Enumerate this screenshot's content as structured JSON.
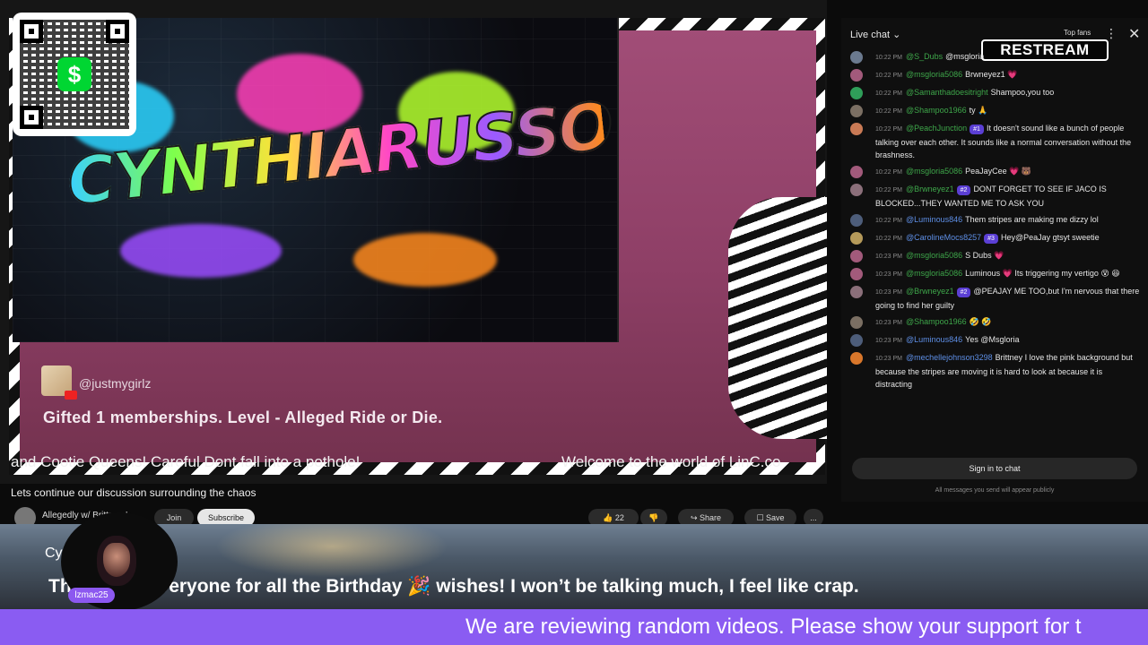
{
  "banner": {
    "title": "CYNTHIARUSSO"
  },
  "gift": {
    "username": "@justmygirlz",
    "message": "Gifted 1 memberships. Level - Alleged Ride or Die."
  },
  "tickers": {
    "top_left": "and Cootie Queens!  Careful Dont fall into a pothole!",
    "top_right": "Welcome to the world of LinC.co",
    "bottom": "We are reviewing random videos. Please show your support for t"
  },
  "video": {
    "title": "Lets continue our discussion surrounding the chaos",
    "channel": "Allegedly w/ Brittney L",
    "join_label": "Join",
    "subscribe_label": "Subscribe",
    "likes": "22",
    "share_label": "Share",
    "save_label": "Save",
    "more_label": "..."
  },
  "chat": {
    "header_label": "Live chat",
    "top_fans_label": "Top fans",
    "restream_label": "RESTREAM",
    "messages": [
      {
        "time": "10:22 PM",
        "user": "@S_Dubs",
        "text": "@msgloria",
        "color": "#6b7a8f"
      },
      {
        "time": "10:22 PM",
        "user": "@msgloria5086",
        "text": "Brwneyez1 💗",
        "color": "#a25a7b"
      },
      {
        "time": "10:22 PM",
        "user": "@Samanthadoesitright",
        "text": "Shampoo,you too",
        "color": "#2f9e59"
      },
      {
        "time": "10:22 PM",
        "user": "@Shampoo1966",
        "text": "ty 🙏",
        "color": "#7b6f63"
      },
      {
        "time": "10:22 PM",
        "user": "@PeachJunction",
        "badge": "#1",
        "text": "It doesn't sound like a bunch of people talking over each other. It sounds like a normal conversation without the brashness.",
        "color": "#c97a55"
      },
      {
        "time": "10:22 PM",
        "user": "@msgloria5086",
        "text": "PeaJayCee 💗 🐻",
        "color": "#a25a7b"
      },
      {
        "time": "10:22 PM",
        "user": "@Brwneyez1",
        "badge": "#2",
        "text": "DONT FORGET TO SEE IF JACO IS BLOCKED...THEY WANTED ME TO ASK YOU",
        "color": "#8b6f7a"
      },
      {
        "time": "10:22 PM",
        "user": "@Luminous846",
        "text": "Them stripes are making me dizzy lol",
        "color": "#4d5d7a"
      },
      {
        "time": "10:22 PM",
        "user": "@CarolineMocs8257",
        "badge": "#3",
        "text": "Hey@PeaJay gtsyt sweetie",
        "color": "#b59a5a"
      },
      {
        "time": "10:23 PM",
        "user": "@msgloria5086",
        "text": "S Dubs 💗",
        "color": "#a25a7b"
      },
      {
        "time": "10:23 PM",
        "user": "@msgloria5086",
        "text": "Luminous 💗 Its triggering my vertigo 😵 😆",
        "color": "#a25a7b"
      },
      {
        "time": "10:23 PM",
        "user": "@Brwneyez1",
        "badge": "#2",
        "text": "@PEAJAY ME TOO,but I'm nervous that there going to find her guilty",
        "color": "#8b6f7a"
      },
      {
        "time": "10:23 PM",
        "user": "@Shampoo1966",
        "text": "🤣 🤣",
        "color": "#7b6f63"
      },
      {
        "time": "10:23 PM",
        "user": "@Luminous846",
        "text": "Yes @Msgloria",
        "color": "#4d5d7a"
      },
      {
        "time": "10:23 PM",
        "user": "@mechellejohnson3298",
        "text": "Brittney I love the pink background but because the stripes are moving it is hard to look at because it is distracting",
        "color": "#d9772b"
      }
    ],
    "sign_in_label": "Sign in to chat",
    "public_note": "All messages you send will appear publicly"
  },
  "lower_third": {
    "title": "Cynthia Russo",
    "message": "Thank you everyone for all the Birthday 🎉 wishes! I won’t be talking much, I feel like crap."
  },
  "host": {
    "tag": "lzmac25"
  },
  "colors": {
    "accent_purple": "#8a5cf2",
    "pink_bg": "#a14d77",
    "cashapp_green": "#00d632"
  }
}
